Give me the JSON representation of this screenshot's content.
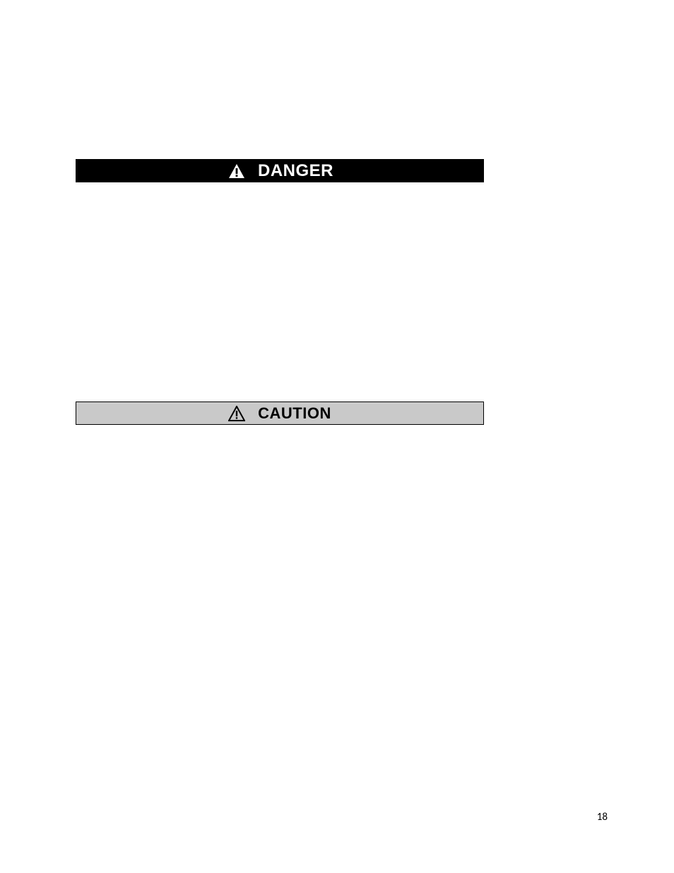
{
  "banners": {
    "danger": {
      "label": "DANGER",
      "icon": "alert-triangle"
    },
    "caution": {
      "label": "CAUTION",
      "icon": "alert-triangle"
    }
  },
  "page_number": "18"
}
